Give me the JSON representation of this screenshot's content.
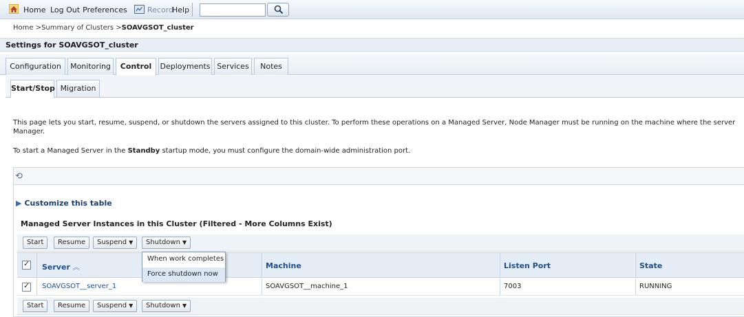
{
  "topbar": {
    "home": "Home",
    "logout": "Log Out",
    "preferences": "Preferences",
    "record": "Record",
    "help": "Help",
    "search_value": ""
  },
  "breadcrumb": {
    "prefix": "Home >Summary of Clusters >",
    "current": "SOAVGSOT_cluster"
  },
  "settings_title": "Settings for SOAVGSOT_cluster",
  "tabs": [
    "Configuration",
    "Monitoring",
    "Control",
    "Deployments",
    "Services",
    "Notes"
  ],
  "active_tab": "Control",
  "subtabs": [
    "Start/Stop",
    "Migration"
  ],
  "active_subtab": "Start/Stop",
  "description": {
    "line1": "This page lets you start, resume, suspend, or shutdown the servers assigned to this cluster. To perform these operations on a Managed Server, Node Manager must be running on the machine where the server",
    "line1b": "Manager.",
    "line2_pre": "To start a Managed Server in the ",
    "line2_bold": "Standby",
    "line2_post": " startup mode, you must configure the domain-wide administration port."
  },
  "customize_link": "Customize this table",
  "table_caption": "Managed Server Instances in this Cluster (Filtered - More Columns Exist)",
  "buttons": {
    "start": "Start",
    "resume": "Resume",
    "suspend": "Suspend",
    "shutdown": "Shutdown"
  },
  "shutdown_menu": [
    "When work completes",
    "Force shutdown now"
  ],
  "columns": [
    "Server",
    "Machine",
    "Listen Port",
    "State"
  ],
  "rows": [
    {
      "server": "SOAVGSOT__server_1",
      "machine": "SOAVGSOT__machine_1",
      "listen_port": "7003",
      "state": "RUNNING",
      "checked": true
    }
  ],
  "header_checked": true,
  "icons": {
    "home": "home-icon",
    "record": "record-icon",
    "search": "search-icon",
    "refresh": "refresh-icon",
    "customize": "expand-arrow-icon",
    "sort": "sort-ascending-icon"
  },
  "colors": {
    "link": "#1d4f91",
    "header_bg": "#e4edf6",
    "bar_bg": "#dde7f2"
  }
}
